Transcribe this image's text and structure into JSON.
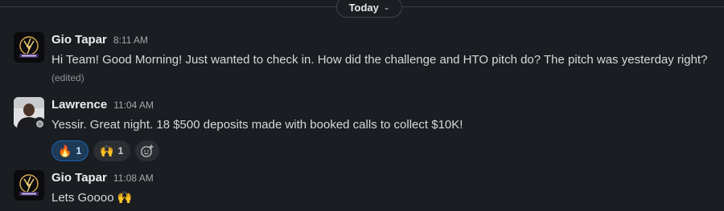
{
  "divider": {
    "label": "Today",
    "chevron_icon": "chevron-down-icon"
  },
  "messages": [
    {
      "sender": "Gio Tapar",
      "time": "8:11 AM",
      "text": "Hi Team! Good Morning! Just wanted to check in. How did the challenge and HTO pitch do? The pitch was yesterday right?",
      "edited": "(edited)"
    },
    {
      "sender": "Lawrence",
      "time": "11:04 AM",
      "text": "Yessir. Great night. 18 $500 deposits made with booked calls to collect $10K!",
      "reactions": [
        {
          "emoji": "🔥",
          "count": "1",
          "active": true
        },
        {
          "emoji": "🙌",
          "count": "1",
          "active": false
        }
      ],
      "add_reaction_icon": "add-reaction-icon"
    },
    {
      "sender": "Gio Tapar",
      "time": "11:08 AM",
      "text": "Lets Goooo 🙌"
    }
  ]
}
